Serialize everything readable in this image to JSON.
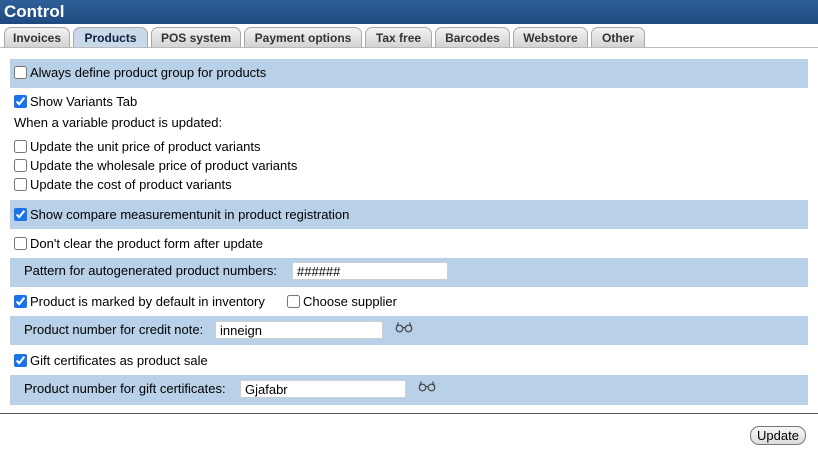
{
  "title": "Control",
  "tabs": [
    {
      "label": "Invoices",
      "active": false
    },
    {
      "label": "Products",
      "active": true
    },
    {
      "label": "POS system",
      "active": false
    },
    {
      "label": "Payment options",
      "active": false
    },
    {
      "label": "Tax free",
      "active": false
    },
    {
      "label": "Barcodes",
      "active": false
    },
    {
      "label": "Webstore",
      "active": false
    },
    {
      "label": "Other",
      "active": false
    }
  ],
  "settings": {
    "always_define_group": {
      "label": "Always define product group for products",
      "checked": false
    },
    "show_variants_tab": {
      "label": "Show Variants Tab",
      "checked": true
    },
    "variable_update_heading": "When a variable product is updated:",
    "update_unit_price": {
      "label": "Update the unit price of product variants",
      "checked": false
    },
    "update_wholesale_price": {
      "label": "Update the wholesale price of product variants",
      "checked": false
    },
    "update_cost": {
      "label": "Update the cost of product variants",
      "checked": false
    },
    "show_compare_unit": {
      "label": "Show compare measurementunit in product registration",
      "checked": true
    },
    "dont_clear_form": {
      "label": "Don't clear the product form after update",
      "checked": false
    },
    "pattern_label": "Pattern for autogenerated product numbers:",
    "pattern_value": "######",
    "marked_in_inventory": {
      "label": "Product is marked by default in inventory",
      "checked": true
    },
    "choose_supplier": {
      "label": "Choose supplier",
      "checked": false
    },
    "credit_note_label": "Product number for credit note:",
    "credit_note_value": "inneign",
    "gift_cert_sale": {
      "label": "Gift certificates as product sale",
      "checked": true
    },
    "gift_cert_number_label": "Product number for gift certificates:",
    "gift_cert_number_value": "Gjafabr"
  },
  "update_button": "Update",
  "colors": {
    "accent_bar": "#b8d0e8",
    "title_bg": "#2f5f98",
    "active_tab": "#c9d9ea"
  }
}
